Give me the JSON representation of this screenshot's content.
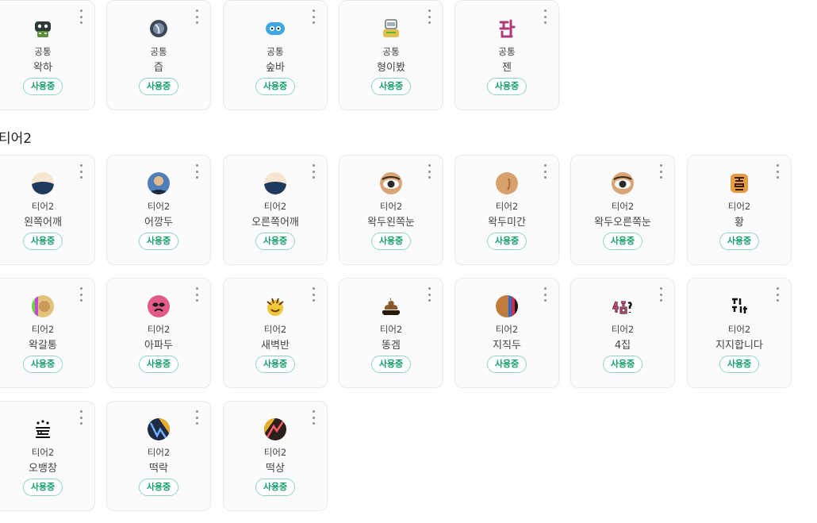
{
  "status_label": "사용중",
  "common_section": {
    "cards": [
      {
        "tier": "공통",
        "name": "왁하",
        "icon": "wakha-emote-icon"
      },
      {
        "tier": "공통",
        "name": "즙",
        "icon": "jeup-emote-icon"
      },
      {
        "tier": "공통",
        "name": "숲바",
        "icon": "supba-emote-icon"
      },
      {
        "tier": "공통",
        "name": "형이봤",
        "icon": "hyeongibwat-emote-icon"
      },
      {
        "tier": "공통",
        "name": "젠",
        "icon": "jen-emote-icon"
      }
    ]
  },
  "tier2_section": {
    "title": "티어2",
    "cards": [
      {
        "tier": "티어2",
        "name": "왼쪽어깨",
        "icon": "left-shoulder-emote-icon"
      },
      {
        "tier": "티어2",
        "name": "어깡두",
        "icon": "eokkangdu-emote-icon"
      },
      {
        "tier": "티어2",
        "name": "오른쪽어깨",
        "icon": "right-shoulder-emote-icon"
      },
      {
        "tier": "티어2",
        "name": "왁두왼쪽눈",
        "icon": "wakdu-left-eye-emote-icon"
      },
      {
        "tier": "티어2",
        "name": "왁두미간",
        "icon": "wakdu-migan-emote-icon"
      },
      {
        "tier": "티어2",
        "name": "왁두오른쪽눈",
        "icon": "wakdu-right-eye-emote-icon"
      },
      {
        "tier": "티어2",
        "name": "황",
        "icon": "hwang-emote-icon"
      },
      {
        "tier": "티어2",
        "name": "왁갈통",
        "icon": "wakgaltong-emote-icon"
      },
      {
        "tier": "티어2",
        "name": "아파두",
        "icon": "apadu-emote-icon"
      },
      {
        "tier": "티어2",
        "name": "새벽반",
        "icon": "saebyeokban-emote-icon"
      },
      {
        "tier": "티어2",
        "name": "똥겜",
        "icon": "ttonggem-emote-icon"
      },
      {
        "tier": "티어2",
        "name": "지직두",
        "icon": "jijikdu-emote-icon"
      },
      {
        "tier": "티어2",
        "name": "4집",
        "icon": "4jip-emote-icon"
      },
      {
        "tier": "티어2",
        "name": "지지합니다",
        "icon": "jijihamnida-emote-icon"
      },
      {
        "tier": "티어2",
        "name": "오뱅창",
        "icon": "obaengchang-emote-icon"
      },
      {
        "tier": "티어2",
        "name": "떡락",
        "icon": "tteokrak-emote-icon"
      },
      {
        "tier": "티어2",
        "name": "떡상",
        "icon": "tteoksang-emote-icon"
      }
    ]
  },
  "colors": {
    "status_green": "#15a06b",
    "status_border": "#8fd7b9",
    "card_border": "#e9e9e9"
  }
}
